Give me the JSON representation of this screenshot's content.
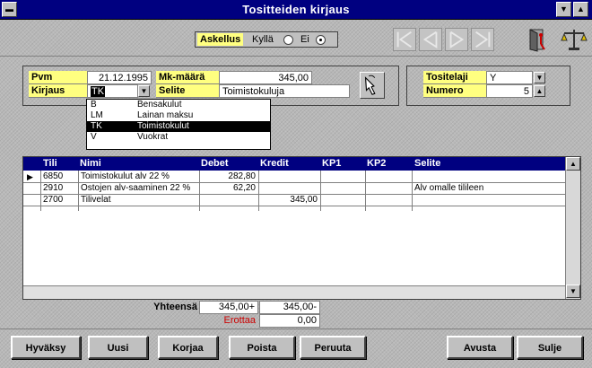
{
  "window": {
    "title": "Tositteiden kirjaus",
    "menu_icon": "system-menu-icon",
    "minimize_icon": "minimize-arrow-icon",
    "maximize_icon": "maximize-arrow-icon"
  },
  "toolbar": {
    "askellus_label": "Askellus",
    "option_yes": "Kyllä",
    "option_no": "Ei",
    "selected": "Ei",
    "nav_icons": [
      "first-record-icon",
      "previous-record-icon",
      "next-record-icon",
      "last-record-icon"
    ],
    "right_icons": [
      "exit-door-icon",
      "scales-icon"
    ]
  },
  "header": {
    "pvm_label": "Pvm",
    "pvm_value": "21.12.1995",
    "kirjaus_label": "Kirjaus",
    "kirjaus_value": "TK",
    "mk_maara_label": "Mk-määrä",
    "mk_maara_value": "345,00",
    "selite_label": "Selite",
    "selite_value": "Toimistokuluja",
    "tositelaji_label": "Tositelaji",
    "tositelaji_value": "Y",
    "numero_label": "Numero",
    "numero_value": "5"
  },
  "dropdown": {
    "items": [
      {
        "code": "B",
        "name": "Bensakulut"
      },
      {
        "code": "LM",
        "name": "Lainan maksu"
      },
      {
        "code": "TK",
        "name": "Toimistokulut"
      },
      {
        "code": "V",
        "name": "Vuokrat"
      }
    ],
    "selected": "TK"
  },
  "grid": {
    "columns": [
      "Tili",
      "Nimi",
      "Debet",
      "Kredit",
      "KP1",
      "KP2",
      "Selite"
    ],
    "rows": [
      {
        "tili": "6850",
        "nimi": "Toimistokulut alv 22 %",
        "debet": "282,80",
        "kredit": "",
        "kp1": "",
        "kp2": "",
        "selite": ""
      },
      {
        "tili": "2910",
        "nimi": "Ostojen alv-saaminen 22 %",
        "debet": "62,20",
        "kredit": "",
        "kp1": "",
        "kp2": "",
        "selite": "Alv omalle tilileen"
      },
      {
        "tili": "2700",
        "nimi": "Tilivelat",
        "debet": "",
        "kredit": "345,00",
        "kp1": "",
        "kp2": "",
        "selite": ""
      }
    ],
    "current_row_marker": "▶"
  },
  "totals": {
    "yhteensa_label": "Yhteensä",
    "debet_total": "345,00+",
    "kredit_total": "345,00-",
    "erottaa_label": "Erottaa",
    "erottaa_value": "0,00"
  },
  "buttons": {
    "hyvaksy": "Hyväksy",
    "uusi": "Uusi",
    "korjaa": "Korjaa",
    "poista": "Poista",
    "peruuta": "Peruuta",
    "avusta": "Avusta",
    "sulje": "Sulje"
  },
  "colors": {
    "title_bar": "#000080",
    "label_bg": "#ffff80",
    "selection": "#000000",
    "erottaa_text": "#cc0000"
  }
}
